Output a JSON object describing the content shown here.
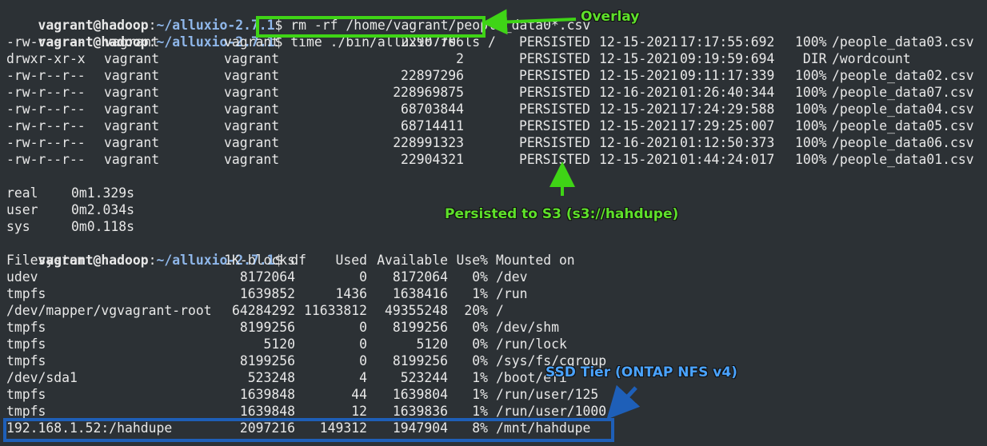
{
  "prompt": {
    "user": "vagrant@hadoop",
    "colon": ":",
    "path": "~/alluxio-2.7.1",
    "dollar": "$"
  },
  "commands": {
    "rm": " rm -rf /home/vagrant/people_data0*.csv",
    "ls": " time ./bin/alluxio fs ls /",
    "df": " df"
  },
  "ls_rows": [
    {
      "perm": "-rw-r--r--",
      "owner": "vagrant",
      "group": "vagrant",
      "size": "22907706",
      "status": "PERSISTED",
      "date": "12-15-2021",
      "time": "17:17:55:692",
      "pct": "100%",
      "path": "/people_data03.csv"
    },
    {
      "perm": "drwxr-xr-x",
      "owner": "vagrant",
      "group": "vagrant",
      "size": "2",
      "status": "PERSISTED",
      "date": "12-15-2021",
      "time": "09:19:59:694",
      "pct": " DIR",
      "path": "/wordcount"
    },
    {
      "perm": "-rw-r--r--",
      "owner": "vagrant",
      "group": "vagrant",
      "size": "22897296",
      "status": "PERSISTED",
      "date": "12-15-2021",
      "time": "09:11:17:339",
      "pct": "100%",
      "path": "/people_data02.csv"
    },
    {
      "perm": "-rw-r--r--",
      "owner": "vagrant",
      "group": "vagrant",
      "size": "228969875",
      "status": "PERSISTED",
      "date": "12-16-2021",
      "time": "01:26:40:344",
      "pct": "100%",
      "path": "/people_data07.csv"
    },
    {
      "perm": "-rw-r--r--",
      "owner": "vagrant",
      "group": "vagrant",
      "size": "68703844",
      "status": "PERSISTED",
      "date": "12-15-2021",
      "time": "17:24:29:588",
      "pct": "100%",
      "path": "/people_data04.csv"
    },
    {
      "perm": "-rw-r--r--",
      "owner": "vagrant",
      "group": "vagrant",
      "size": "68714411",
      "status": "PERSISTED",
      "date": "12-15-2021",
      "time": "17:29:25:007",
      "pct": "100%",
      "path": "/people_data05.csv"
    },
    {
      "perm": "-rw-r--r--",
      "owner": "vagrant",
      "group": "vagrant",
      "size": "228991323",
      "status": "PERSISTED",
      "date": "12-16-2021",
      "time": "01:12:50:373",
      "pct": "100%",
      "path": "/people_data06.csv"
    },
    {
      "perm": "-rw-r--r--",
      "owner": "vagrant",
      "group": "vagrant",
      "size": "22904321",
      "status": "PERSISTED",
      "date": "12-15-2021",
      "time": "01:44:24:017",
      "pct": "100%",
      "path": "/people_data01.csv"
    }
  ],
  "timing": [
    {
      "label": "real",
      "value": "0m1.329s"
    },
    {
      "label": "user",
      "value": "0m2.034s"
    },
    {
      "label": "sys",
      "value": "0m0.118s"
    }
  ],
  "df_header": {
    "fs": "Filesystem",
    "blocks": "1K-blocks",
    "used": "Used",
    "avail": "Available",
    "usep": "Use%",
    "mount": "Mounted on"
  },
  "df_rows": [
    {
      "fs": "udev",
      "blocks": "8172064",
      "used": "0",
      "avail": "8172064",
      "usep": "0%",
      "mount": "/dev"
    },
    {
      "fs": "tmpfs",
      "blocks": "1639852",
      "used": "1436",
      "avail": "1638416",
      "usep": "1%",
      "mount": "/run"
    },
    {
      "fs": "/dev/mapper/vgvagrant-root",
      "blocks": "64284292",
      "used": "11633812",
      "avail": "49355248",
      "usep": "20%",
      "mount": "/"
    },
    {
      "fs": "tmpfs",
      "blocks": "8199256",
      "used": "0",
      "avail": "8199256",
      "usep": "0%",
      "mount": "/dev/shm"
    },
    {
      "fs": "tmpfs",
      "blocks": "5120",
      "used": "0",
      "avail": "5120",
      "usep": "0%",
      "mount": "/run/lock"
    },
    {
      "fs": "tmpfs",
      "blocks": "8199256",
      "used": "0",
      "avail": "8199256",
      "usep": "0%",
      "mount": "/sys/fs/cgroup"
    },
    {
      "fs": "/dev/sda1",
      "blocks": "523248",
      "used": "4",
      "avail": "523244",
      "usep": "1%",
      "mount": "/boot/efi"
    },
    {
      "fs": "tmpfs",
      "blocks": "1639848",
      "used": "44",
      "avail": "1639804",
      "usep": "1%",
      "mount": "/run/user/125"
    },
    {
      "fs": "tmpfs",
      "blocks": "1639848",
      "used": "12",
      "avail": "1639836",
      "usep": "1%",
      "mount": "/run/user/1000"
    },
    {
      "fs": "192.168.1.52:/hahdupe",
      "blocks": "2097216",
      "used": "149312",
      "avail": "1947904",
      "usep": "8%",
      "mount": "/mnt/hahdupe"
    }
  ],
  "annotations": {
    "overlay": "Overlay",
    "persisted": "Persisted to S3 (s3://hahdupe)",
    "ssd": "SSD Tier (ONTAP NFS v4)"
  },
  "colors": {
    "background": "#2c3135",
    "path": "#8fb7ea",
    "green": "#3fd416",
    "blue": "#1e5fb8",
    "annot_green": "#5ee02a",
    "annot_blue": "#4aa3ff"
  }
}
